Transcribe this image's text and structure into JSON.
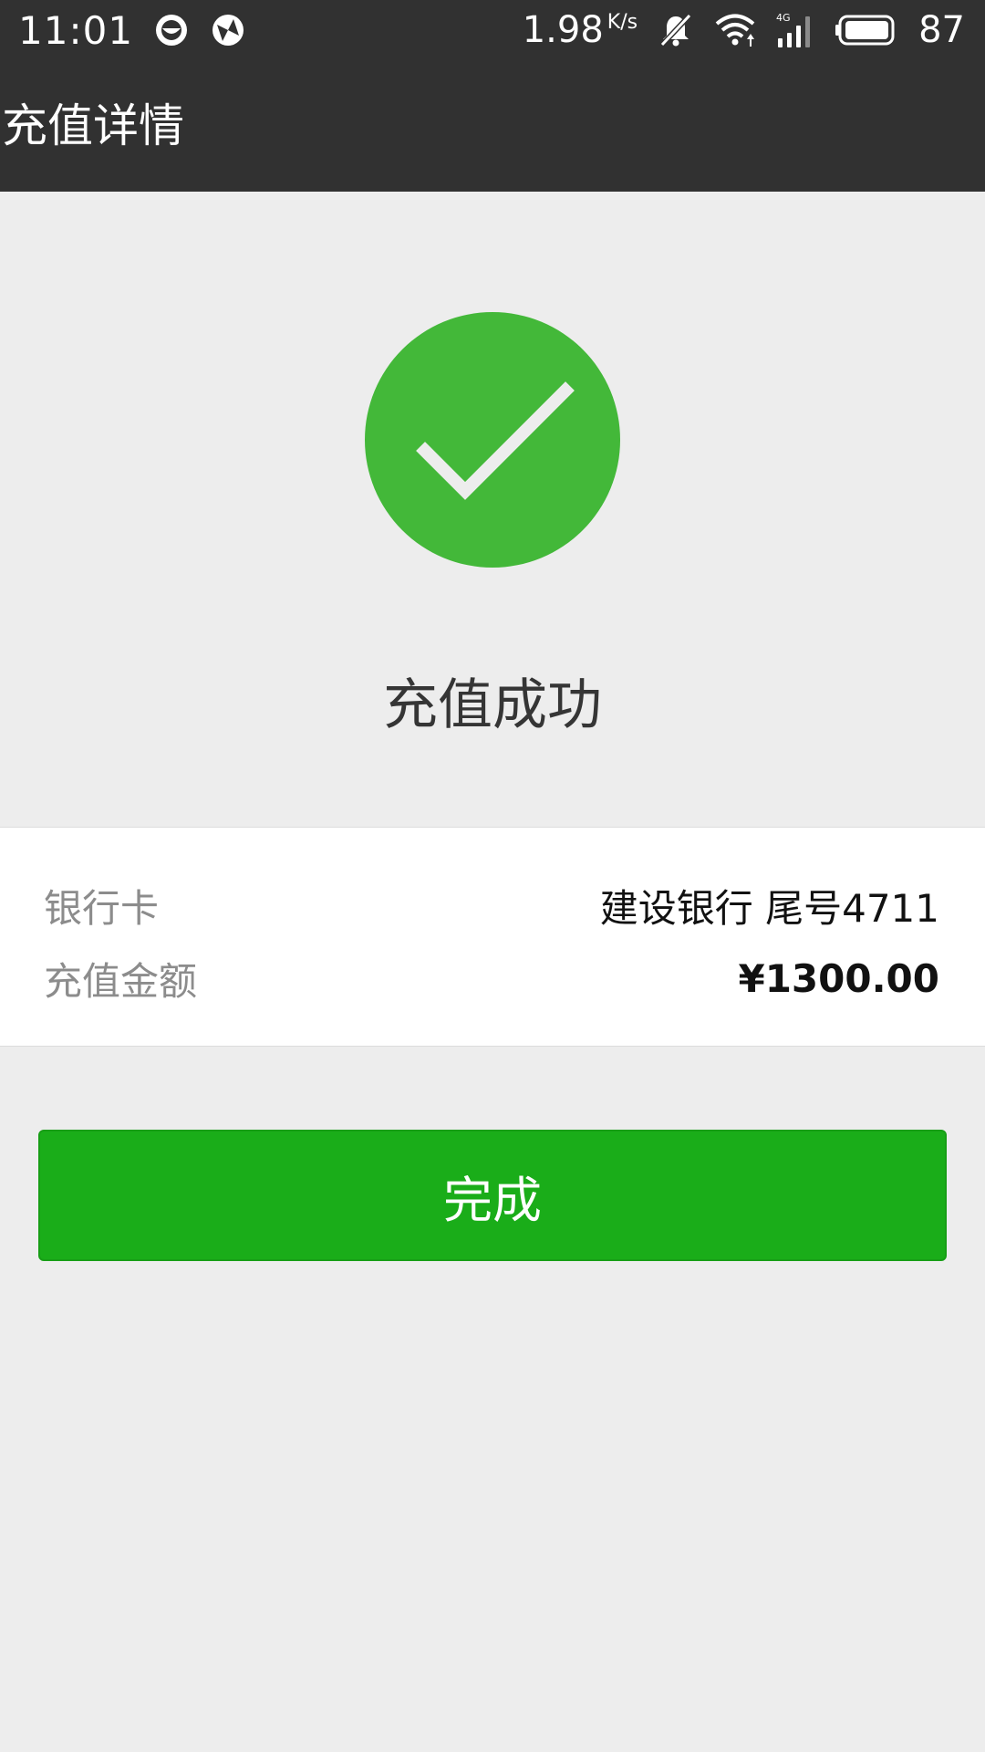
{
  "status_bar": {
    "time": "11:01",
    "net_speed_value": "1.98",
    "net_speed_unit": "K/s",
    "battery_level": "87",
    "network_type": "4G",
    "icons": [
      "app-notification-icon",
      "app-sync-icon",
      "muted-bell-icon",
      "wifi-icon",
      "cell-signal-icon",
      "battery-icon"
    ]
  },
  "toolbar": {
    "title": "充值详情"
  },
  "result": {
    "status_text": "充值成功",
    "icon": "success-check-icon",
    "accent_color": "#43b839"
  },
  "details": {
    "bank_card_label": "银行卡",
    "bank_card_value": "建设银行 尾号4711",
    "amount_label": "充值金额",
    "amount_value": "¥1300.00"
  },
  "actions": {
    "done_label": "完成",
    "button_color": "#1aad19"
  }
}
